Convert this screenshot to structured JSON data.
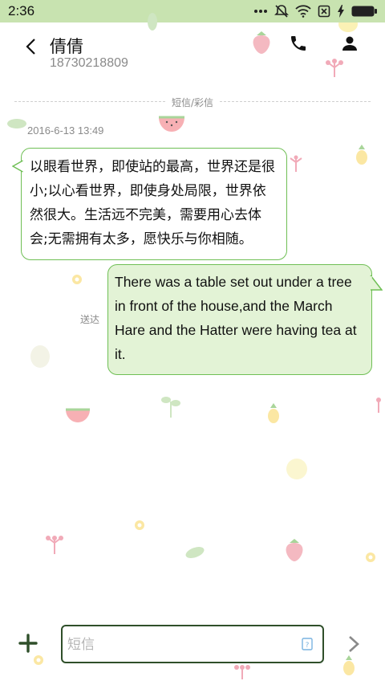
{
  "status_bar": {
    "time": "2:36",
    "icons": [
      "more-icon",
      "mute-icon",
      "wifi-icon",
      "sim-off-icon",
      "bolt-icon",
      "battery-icon"
    ]
  },
  "header": {
    "contact_name": "倩倩",
    "phone_number": "18730218809"
  },
  "conversation": {
    "channel_label": "短信/彩信",
    "timestamp": "2016-6-13 13:49",
    "incoming_message": {
      "text": "以眼看世界，即使站的最高，世界还是很小;以心看世界，即使身处局限，世界依然很大。生活远不完美，需要用心去体会;无需拥有太多，愿快乐与你相随。"
    },
    "outgoing_message": {
      "text": "There was a table set out under a tree in front of the house,and the March Hare and the Hatter were having tea at it.",
      "status": "送达"
    }
  },
  "composer": {
    "placeholder": "短信",
    "value": ""
  },
  "colors": {
    "status_bar_bg": "#c8e3b0",
    "bubble_border": "#6fbf55",
    "outgoing_bubble_bg": "#e3f3d6",
    "composer_border": "#2f4f2a"
  }
}
